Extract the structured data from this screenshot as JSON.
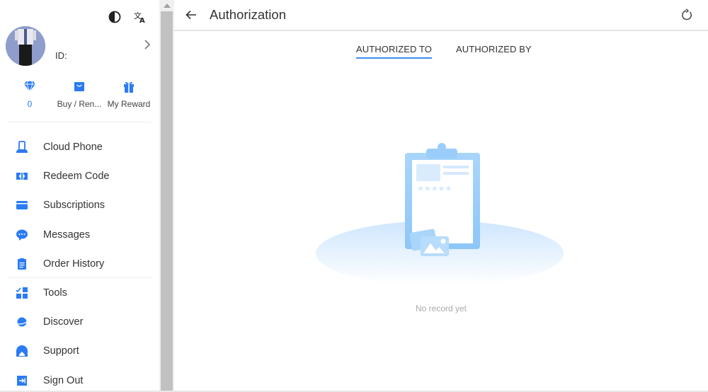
{
  "sidebar": {
    "profile": {
      "id_label": "ID:"
    },
    "quick_actions": [
      {
        "label": "0",
        "icon": "diamond-icon"
      },
      {
        "label": "Buy / Ren...",
        "icon": "shopping-bag-icon"
      },
      {
        "label": "My Reward",
        "icon": "gift-icon"
      }
    ],
    "nav_group_1": [
      {
        "label": "Cloud Phone",
        "icon": "cloud-phone-icon"
      },
      {
        "label": "Redeem Code",
        "icon": "ticket-icon"
      },
      {
        "label": "Subscriptions",
        "icon": "card-icon"
      },
      {
        "label": "Messages",
        "icon": "chat-bubble-icon"
      },
      {
        "label": "Order History",
        "icon": "clipboard-icon"
      }
    ],
    "nav_group_2": [
      {
        "label": "Tools",
        "icon": "tools-grid-icon"
      },
      {
        "label": "Discover",
        "icon": "planet-icon"
      },
      {
        "label": "Support",
        "icon": "support-icon"
      },
      {
        "label": "Sign Out",
        "icon": "sign-out-icon"
      }
    ]
  },
  "header": {
    "title": "Authorization"
  },
  "tabs": [
    {
      "label": "AUTHORIZED TO",
      "active": true
    },
    {
      "label": "AUTHORIZED BY",
      "active": false
    }
  ],
  "empty_state": {
    "message": "No record yet"
  },
  "colors": {
    "accent": "#2b7bf3",
    "tab_underline": "#3c8cf0",
    "illustration_light": "#bfe0fd"
  }
}
